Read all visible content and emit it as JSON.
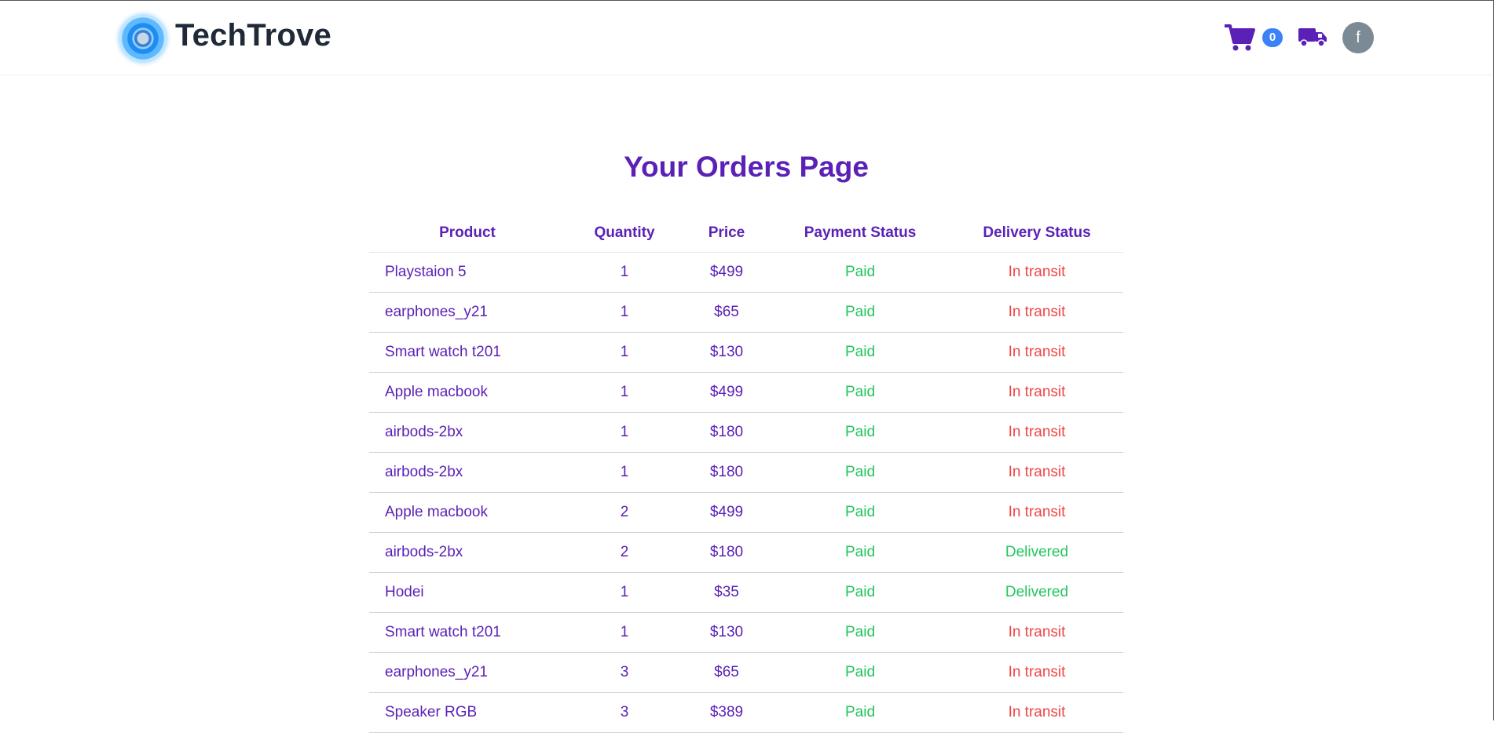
{
  "brand": {
    "name": "TechTrove"
  },
  "header": {
    "cart_count": "0",
    "avatar_initial": "f"
  },
  "page": {
    "title": "Your Orders Page"
  },
  "table": {
    "columns": [
      "Product",
      "Quantity",
      "Price",
      "Payment Status",
      "Delivery Status"
    ],
    "rows": [
      {
        "product": "Playstaion 5",
        "quantity": "1",
        "price": "$499",
        "payment": "Paid",
        "delivery": "In transit"
      },
      {
        "product": "earphones_y21",
        "quantity": "1",
        "price": "$65",
        "payment": "Paid",
        "delivery": "In transit"
      },
      {
        "product": "Smart watch t201",
        "quantity": "1",
        "price": "$130",
        "payment": "Paid",
        "delivery": "In transit"
      },
      {
        "product": "Apple macbook",
        "quantity": "1",
        "price": "$499",
        "payment": "Paid",
        "delivery": "In transit"
      },
      {
        "product": "airbods-2bx",
        "quantity": "1",
        "price": "$180",
        "payment": "Paid",
        "delivery": "In transit"
      },
      {
        "product": "airbods-2bx",
        "quantity": "1",
        "price": "$180",
        "payment": "Paid",
        "delivery": "In transit"
      },
      {
        "product": "Apple macbook",
        "quantity": "2",
        "price": "$499",
        "payment": "Paid",
        "delivery": "In transit"
      },
      {
        "product": "airbods-2bx",
        "quantity": "2",
        "price": "$180",
        "payment": "Paid",
        "delivery": "Delivered"
      },
      {
        "product": "Hodei",
        "quantity": "1",
        "price": "$35",
        "payment": "Paid",
        "delivery": "Delivered"
      },
      {
        "product": "Smart watch t201",
        "quantity": "1",
        "price": "$130",
        "payment": "Paid",
        "delivery": "In transit"
      },
      {
        "product": "earphones_y21",
        "quantity": "3",
        "price": "$65",
        "payment": "Paid",
        "delivery": "In transit"
      },
      {
        "product": "Speaker RGB",
        "quantity": "3",
        "price": "$389",
        "payment": "Paid",
        "delivery": "In transit"
      }
    ]
  },
  "icons": {
    "cart": "shopping-cart-icon",
    "orders": "truck-icon",
    "logo": "globe-logo"
  },
  "colors": {
    "accent": "#5b21b6",
    "paid": "#22c55e",
    "in_transit": "#ef4444",
    "badge": "#3b82f6"
  }
}
